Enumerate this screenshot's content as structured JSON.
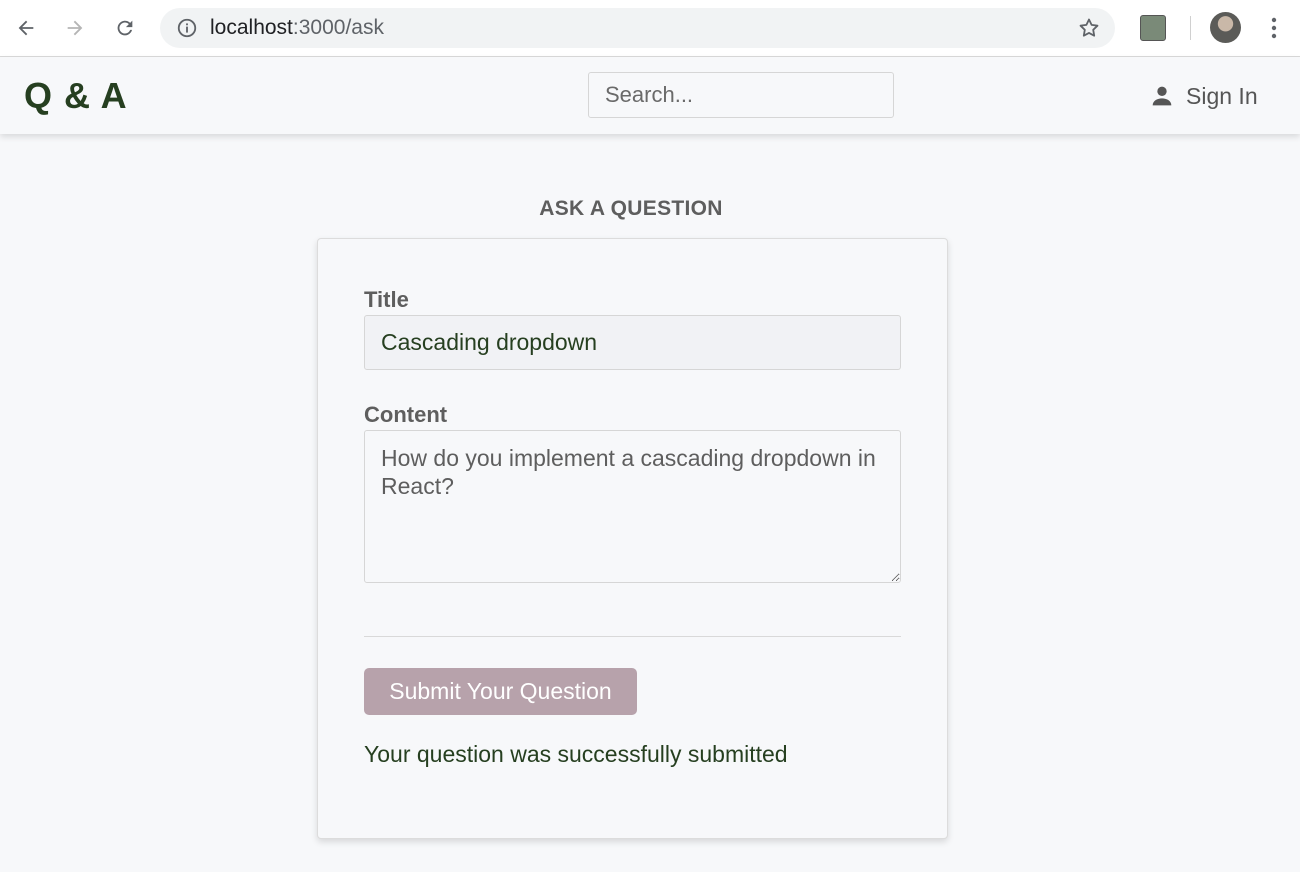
{
  "browser": {
    "url_host": "localhost",
    "url_path": ":3000/ask"
  },
  "header": {
    "logo": "Q & A",
    "search_placeholder": "Search...",
    "signin_label": "Sign In"
  },
  "page": {
    "title": "ASK A QUESTION"
  },
  "form": {
    "title_label": "Title",
    "title_value": "Cascading dropdown",
    "content_label": "Content",
    "content_value": "How do you implement a cascading dropdown in React?",
    "submit_label": "Submit Your Question",
    "success_message": "Your question was successfully submitted"
  },
  "icons": {
    "back": "back-arrow-icon",
    "forward": "forward-arrow-icon",
    "reload": "reload-icon",
    "info": "info-icon",
    "star": "star-icon",
    "extension": "extension-icon",
    "menu": "kebab-menu-icon",
    "user": "user-icon"
  },
  "colors": {
    "brand": "#263f20",
    "submit_button": "#b7a2ab",
    "page_background": "#f7f8fa"
  }
}
